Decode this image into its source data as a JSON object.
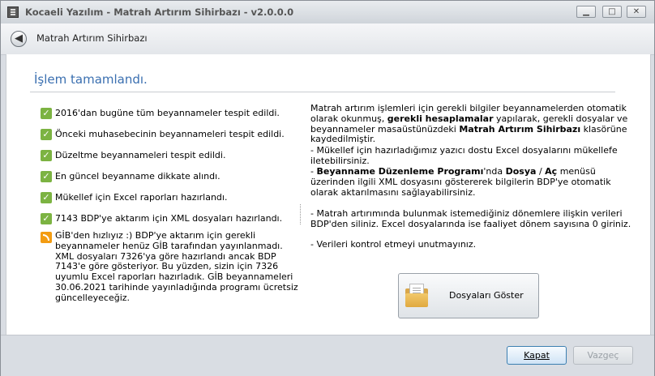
{
  "window": {
    "title": "Kocaeli Yazılım - Matrah Artırım Sihirbazı - v2.0.0.0",
    "controls": {
      "minimize": "▁",
      "maximize": "□",
      "close": "✕"
    }
  },
  "nav": {
    "back_glyph": "◀",
    "title": "Matrah Artırım Sihirbazı"
  },
  "main": {
    "heading": "İşlem tamamlandı.",
    "checklist": [
      "2016'dan bugüne tüm beyannameler tespit edildi.",
      "Önceki muhasebecinin beyannameleri tespit edildi.",
      "Düzeltme beyannameleri tespit edildi.",
      "En güncel beyanname dikkate alındı.",
      "Mükellef için Excel raporları hazırlandı.",
      "7143 BDP'ye aktarım için XML dosyaları hazırlandı."
    ],
    "check_glyph": "✓",
    "note": "GİB'den hızlıyız :) BDP'ye aktarım için gerekli beyannameler henüz GİB tarafından yayınlanmadı. XML dosyaları 7326'ya göre hazırlandı ancak BDP 7143'e göre gösteriyor. Bu yüzden, sizin için 7326 uyumlu Excel raporları hazırladık. GİB beyannameleri 30.06.2021 tarihinde yayınladığında programı ücretsiz güncelleyeceğiz.",
    "info": {
      "p1_a": "Matrah artırım işlemleri için gerekli bilgiler beyannamelerden otomatik olarak okunmuş, ",
      "p1_b": "gerekli hesaplamalar",
      "p1_c": " yapılarak, gerekli dosyalar ve beyannameler masaüstünüzdeki ",
      "p1_d": "Matrah Artırım Sihirbazı",
      "p1_e": " klasörüne kaydedilmiştir.",
      "p2": "- Mükellef için hazırladığımız yazıcı dostu Excel dosyalarını mükellefe iletebilirsiniz.",
      "p3_a": "- ",
      "p3_b": "Beyanname Düzenleme Programı",
      "p3_c": "'nda ",
      "p3_d": "Dosya",
      "p3_e": " / ",
      "p3_f": "Aç",
      "p3_g": " menüsü üzerinden ilgili XML dosyasını göstererek bilgilerin BDP'ye otomatik olarak aktarılmasını sağlayabilirsiniz.",
      "p4": "- Matrah artırımında bulunmak istemediğiniz dönemlere ilişkin verileri BDP'den siliniz. Excel dosyalarında ise faaliyet dönem sayısına 0 giriniz.",
      "p5": "- Verileri kontrol etmeyi unutmayınız."
    },
    "show_files_button": "Dosyaları Göster"
  },
  "footer": {
    "ok_button": "Kapat",
    "cancel_button": "Vazgeç"
  },
  "colors": {
    "heading": "#3a6fb0",
    "check": "#7cb342",
    "rss": "#f39c12",
    "ok_border": "#3c7fb1"
  }
}
